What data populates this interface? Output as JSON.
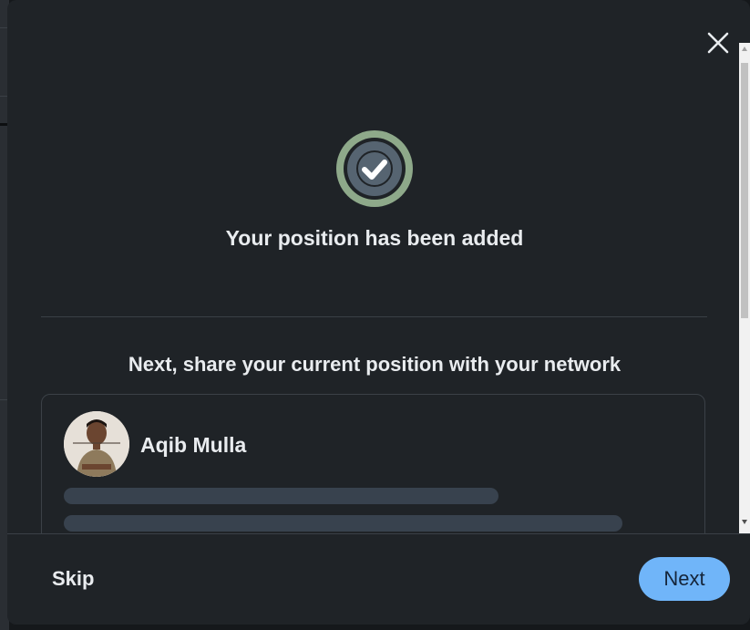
{
  "modal": {
    "success_message": "Your position has been added",
    "share_prompt": "Next, share your current position with your network"
  },
  "post_preview": {
    "author_name": "Aqib Mulla"
  },
  "footer": {
    "skip_label": "Skip",
    "next_label": "Next"
  },
  "colors": {
    "accent": "#70b5f9",
    "success_ring": "#8ea98a",
    "modal_bg": "#1f2327"
  },
  "icons": {
    "close": "close-icon",
    "success": "checkmark-icon"
  }
}
